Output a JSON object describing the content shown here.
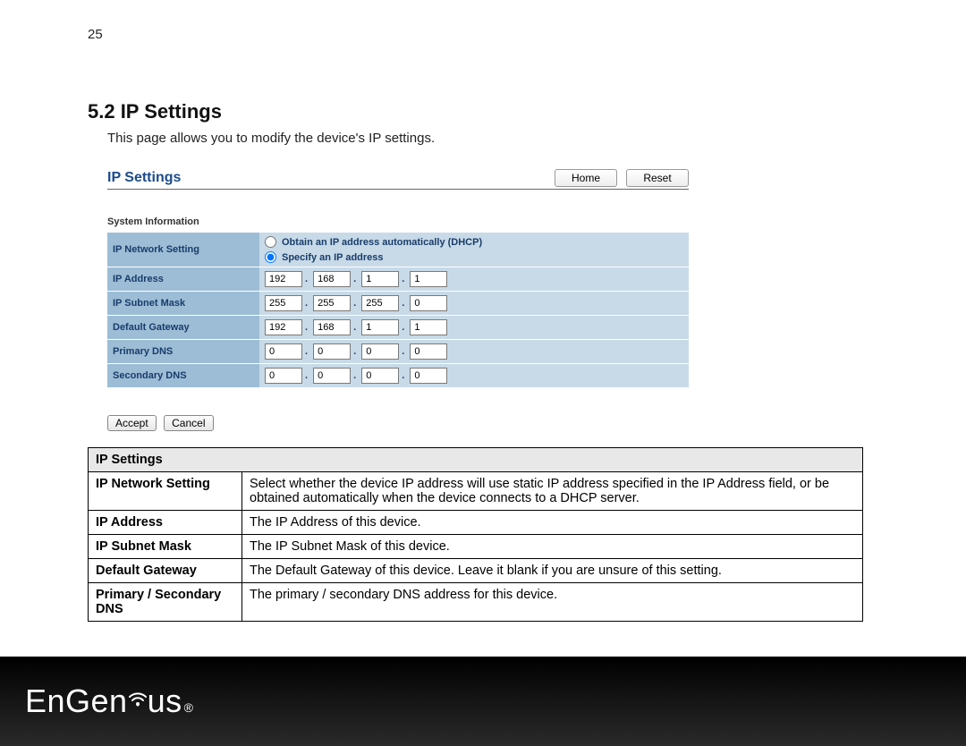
{
  "page_number": "25",
  "heading": "5.2   IP Settings",
  "intro": "This page allows you to modify the device's IP settings.",
  "panel": {
    "title": "IP Settings",
    "home_btn": "Home",
    "reset_btn": "Reset",
    "subhead": "System Information",
    "row_network": "IP Network Setting",
    "opt_dhcp": "Obtain an IP address automatically (DHCP)",
    "opt_static": "Specify an IP address",
    "rows": {
      "ip_address": {
        "label": "IP Address",
        "o1": "192",
        "o2": "168",
        "o3": "1",
        "o4": "1"
      },
      "subnet": {
        "label": "IP Subnet Mask",
        "o1": "255",
        "o2": "255",
        "o3": "255",
        "o4": "0"
      },
      "gateway": {
        "label": "Default Gateway",
        "o1": "192",
        "o2": "168",
        "o3": "1",
        "o4": "1"
      },
      "pdns": {
        "label": "Primary DNS",
        "o1": "0",
        "o2": "0",
        "o3": "0",
        "o4": "0"
      },
      "sdns": {
        "label": "Secondary DNS",
        "o1": "0",
        "o2": "0",
        "o3": "0",
        "o4": "0"
      }
    },
    "accept_btn": "Accept",
    "cancel_btn": "Cancel"
  },
  "desc": {
    "header": "IP Settings",
    "r1k": "IP Network Setting",
    "r1v": "Select whether the device IP address will use static IP address specified in the IP Address field, or be obtained automatically when the device connects to a DHCP server.",
    "r2k": "IP Address",
    "r2v": "The IP Address of this device.",
    "r3k": "IP Subnet Mask",
    "r3v": "The IP Subnet Mask of this device.",
    "r4k": "Default Gateway",
    "r4v": "The Default Gateway of this device. Leave it blank if you are unsure of this setting.",
    "r5k": "Primary / Secondary DNS",
    "r5v": "The primary / secondary DNS address for this device."
  },
  "footer": {
    "brand_a": "EnGen",
    "brand_b": "us",
    "reg": "®"
  }
}
